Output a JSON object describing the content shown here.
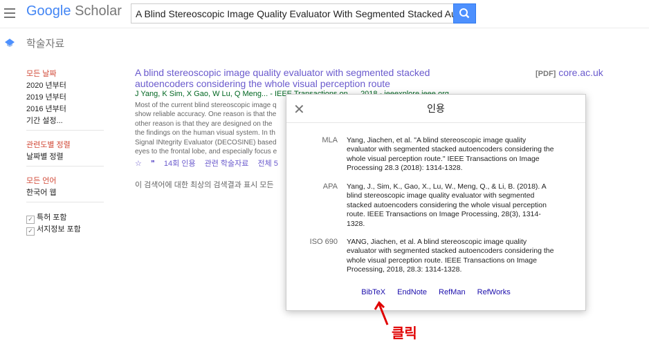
{
  "header": {
    "logo_google": "Google",
    "logo_scholar": "Scholar",
    "search_value": "A Blind Stereoscopic Image Quality Evaluator With Segmented Stacked Autoe"
  },
  "section_title": "학술자료",
  "sidebar": {
    "date": {
      "heading": "모든 날짜",
      "items": [
        "2020 년부터",
        "2019 년부터",
        "2016 년부터",
        "기간 설정..."
      ]
    },
    "sort": {
      "heading": "관련도별 정렬",
      "items": [
        "날짜별 정렬"
      ]
    },
    "lang": {
      "heading": "모든 언어",
      "items": [
        "한국어 웹"
      ]
    },
    "checks": [
      "특허 포함",
      "서지정보 포함"
    ]
  },
  "result": {
    "title_line1": "A blind stereoscopic image quality evaluator with segmented stacked",
    "title_line2": "autoencoders considering the whole visual perception route",
    "pdf_tag": "[PDF]",
    "pdf_source": "core.ac.uk",
    "authors": "J Yang, K Sim, X Gao, W Lu, Q Meng... - IEEE Transactions on ..., 2018 - ieeexplore.ieee.org",
    "snippet": [
      "Most of the current blind stereoscopic image q",
      "show reliable accuracy. One reason is that the",
      "other reason is that they are designed on the",
      "the findings on the human visual system. In th",
      "Signal INtegrity Evaluator (DECOSINE) based",
      "eyes to the frontal lobe, and especially focus e"
    ],
    "actions": {
      "cited": "14회 인용",
      "related": "관련 학술자료",
      "all": "전체 5"
    }
  },
  "footer_note": "이 검색어에 대한 최상의 검색결과 표시 모든",
  "dialog": {
    "title": "인용",
    "citations": [
      {
        "style": "MLA",
        "lines": [
          "Yang, Jiachen, et al. \"A blind stereoscopic image quality",
          "evaluator with segmented stacked autoencoders considering the",
          "whole visual perception route.\" IEEE Transactions on Image",
          "Processing 28.3 (2018): 1314-1328."
        ]
      },
      {
        "style": "APA",
        "lines": [
          "Yang, J., Sim, K., Gao, X., Lu, W., Meng, Q., & Li, B. (2018). A",
          "blind stereoscopic image quality evaluator with segmented",
          "stacked autoencoders considering the whole visual perception",
          "route. IEEE Transactions on Image Processing, 28(3), 1314-",
          "1328."
        ]
      },
      {
        "style": "ISO 690",
        "lines": [
          "YANG, Jiachen, et al. A blind stereoscopic image quality",
          "evaluator with segmented stacked autoencoders considering the",
          "whole visual perception route. IEEE Transactions on Image",
          "Processing, 2018, 28.3: 1314-1328."
        ]
      }
    ],
    "exports": [
      "BibTeX",
      "EndNote",
      "RefMan",
      "RefWorks"
    ]
  },
  "annotation": {
    "label": "클릭",
    "color": "#e00000"
  }
}
